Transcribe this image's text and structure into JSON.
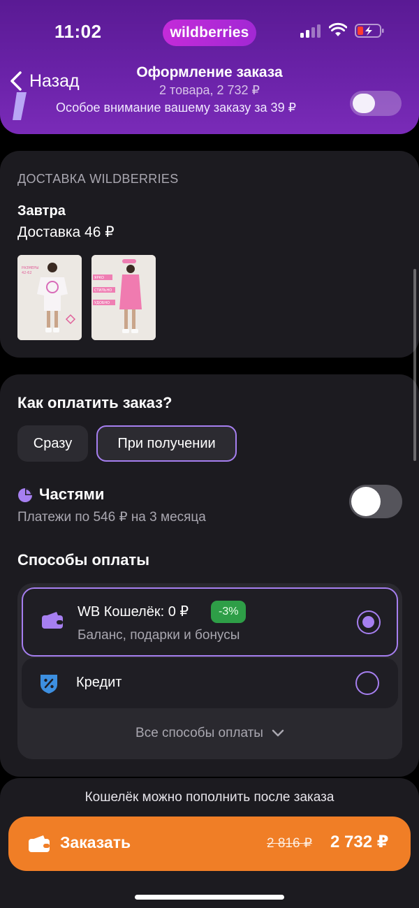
{
  "status_bar": {
    "time": "11:02",
    "brand": "wildberries",
    "cellular_icon": "cellular-signal-icon",
    "wifi_icon": "wifi-icon",
    "battery_icon": "battery-low-charging-icon"
  },
  "nav": {
    "back_label": "Назад",
    "title": "Оформление заказа",
    "subtitle": "2 товара, 2 732 ₽"
  },
  "promo": {
    "text": "Особое внимание вашему заказу за 39 ₽",
    "toggle_on": false
  },
  "delivery": {
    "caption": "ДОСТАВКА WILDBERRIES",
    "day": "Завтра",
    "price": "Доставка 46 ₽",
    "items": [
      {
        "name": "product-thumb-tshirt-dress",
        "label_lines": [
          "РАЗМЕРЫ",
          "42-62"
        ]
      },
      {
        "name": "product-thumb-pink-dress",
        "label_lines": [
          "ЯРКО",
          "СТИЛЬНО",
          "УДОБНО"
        ]
      }
    ]
  },
  "payment": {
    "title": "Как оплатить заказ?",
    "options": [
      {
        "label": "Сразу",
        "selected": false
      },
      {
        "label": "При получении",
        "selected": true
      }
    ],
    "parts_title": "Частями",
    "parts_sub": "Платежи по 546 ₽ на 3 месяца",
    "parts_toggle_on": false,
    "methods_title": "Способы оплаты",
    "methods": [
      {
        "label": "WB Кошелёк: 0 ₽",
        "badge": "-3%",
        "sub": "Баланс, подарки и бонусы",
        "selected": true,
        "icon": "wallet-icon"
      },
      {
        "label": "Кредит",
        "selected": false,
        "icon": "credit-percent-shield-icon"
      }
    ],
    "all_methods": "Все способы оплаты"
  },
  "footer": {
    "wallet_note": "Кошелёк можно пополнить после заказа",
    "order_label": "Заказать",
    "old_price": "2 816 ₽",
    "total": "2 732 ₽"
  },
  "colors": {
    "accent_purple": "#a67ff0",
    "order_orange": "#f07e26",
    "badge_green": "#2e9e47",
    "header_purple": "#6a22a8"
  }
}
